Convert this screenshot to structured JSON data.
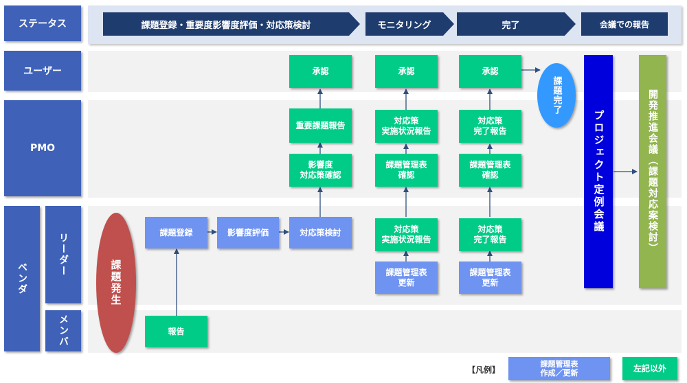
{
  "lanes": {
    "status": "ステータス",
    "user": "ユーザー",
    "pmo": "PMO",
    "vendor": "ベンダ",
    "leader": "リーダー",
    "member": "メンバ"
  },
  "phases": [
    "課題登録・重要度影響度評価・対応策検討",
    "モニタリング",
    "完了",
    "会議での報告"
  ],
  "boxes": {
    "issue_register": "課題登録",
    "impact_eval": "影響度評価",
    "countermeasure": "対応策検討",
    "report": "報告",
    "impact_confirm": "影響度\n対応策確認",
    "important_report": "重要課題報告",
    "approve1": "承認",
    "status_report_leader": "対応策\n実施状況報告",
    "mgmt_update1": "課題管理表\n更新",
    "mgmt_confirm1": "課題管理表\n確認",
    "status_report_pmo": "対応策\n実施状況報告",
    "approve2": "承認",
    "complete_report_leader": "対応策\n完了報告",
    "mgmt_update2": "課題管理表\n更新",
    "mgmt_confirm2": "課題管理表\n確認",
    "complete_report_pmo": "対応策\n完了報告",
    "approve3": "承認"
  },
  "ovals": {
    "issue_occur": "課題発生",
    "issue_done": "課題完了"
  },
  "bars": {
    "project_meeting": "プロジェクト定例会議",
    "dev_meeting": "開発推進会議（課題対応案検討）"
  },
  "legend": {
    "title": "【凡例】",
    "blue_label": "課題管理表\n作成／更新",
    "green_label": "左記以外"
  },
  "colors": {
    "lane_header": "#3f62b8",
    "phase_arrow": "#1f3c6e",
    "green_box": "#00cc88",
    "blue_box": "#6f93f0",
    "red_oval": "#c0504d",
    "blue_oval": "#3399ff",
    "project_bar": "#0000dd",
    "dev_bar": "#92b550"
  }
}
